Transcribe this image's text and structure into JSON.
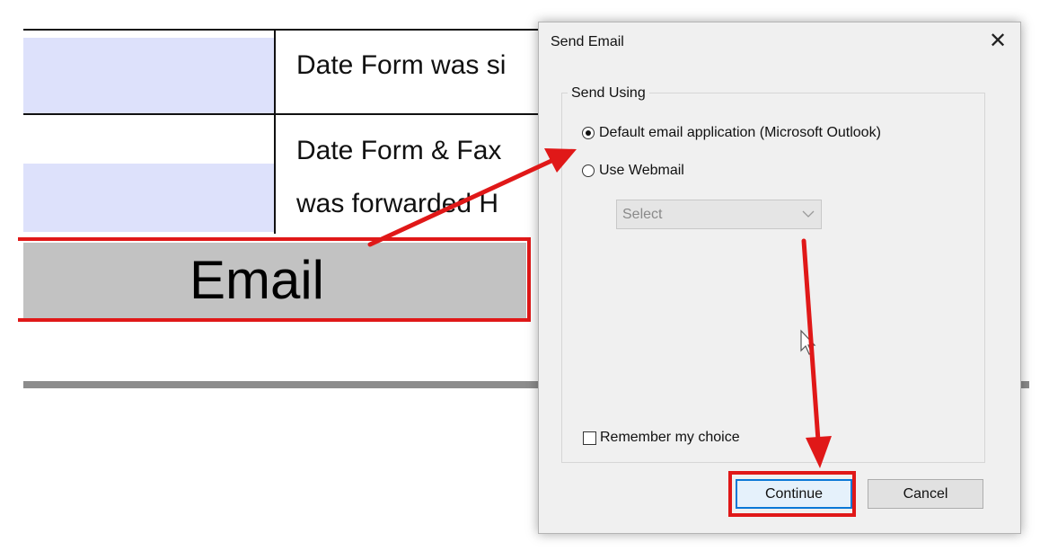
{
  "form": {
    "row1_text": "Date Form was si",
    "row2_text_line1": "Date Form & Fax",
    "row2_text_line2": "was forwarded H",
    "email_button_label": "Email"
  },
  "dialog": {
    "title": "Send Email",
    "close_glyph": "✕",
    "group_label": "Send Using",
    "option_default_label": "Default email application (Microsoft Outlook)",
    "option_default_selected": true,
    "option_webmail_label": "Use Webmail",
    "option_webmail_selected": false,
    "webmail_select_value": "Select",
    "remember_label": "Remember my choice",
    "remember_checked": false,
    "continue_label": "Continue",
    "cancel_label": "Cancel"
  },
  "colors": {
    "annotation_red": "#e01818",
    "focus_blue": "#0a78d7",
    "form_cell_blue": "#dde1fb",
    "email_button_gray": "#c2c2c2"
  },
  "icons": {
    "close": "close-icon",
    "dropdown": "chevron-down-icon",
    "cursor": "mouse-pointer-icon"
  }
}
